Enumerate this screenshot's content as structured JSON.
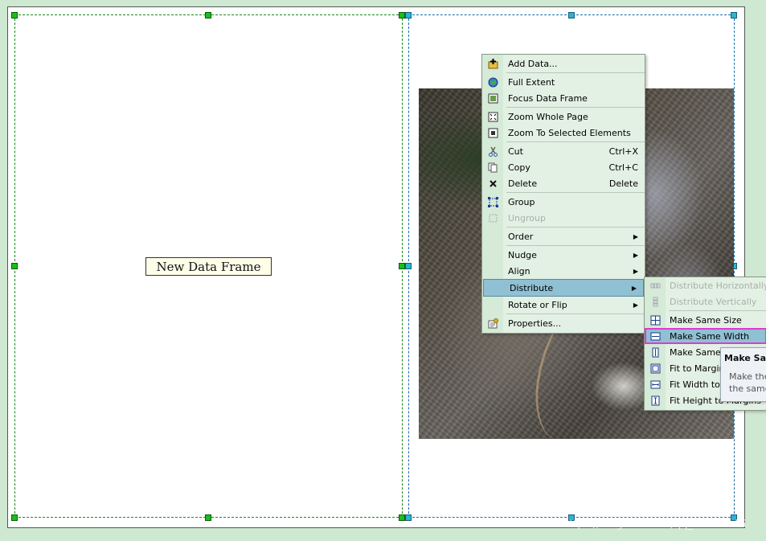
{
  "layout_view": {
    "new_data_frame_label": "New Data Frame"
  },
  "context_menu": {
    "items": [
      {
        "label": "Add Data...",
        "shortcut": "",
        "icon": "add-data-icon",
        "disabled": false,
        "submenu": false
      },
      {
        "label": "Full Extent",
        "shortcut": "",
        "icon": "globe-icon",
        "disabled": false,
        "submenu": false
      },
      {
        "label": "Focus Data Frame",
        "shortcut": "",
        "icon": "focus-frame-icon",
        "disabled": false,
        "submenu": false
      },
      {
        "label": "Zoom Whole Page",
        "shortcut": "",
        "icon": "zoom-page-icon",
        "disabled": false,
        "submenu": false
      },
      {
        "label": "Zoom To Selected Elements",
        "shortcut": "",
        "icon": "zoom-selected-icon",
        "disabled": false,
        "submenu": false
      },
      {
        "label": "Cut",
        "shortcut": "Ctrl+X",
        "icon": "scissors-icon",
        "disabled": false,
        "submenu": false
      },
      {
        "label": "Copy",
        "shortcut": "Ctrl+C",
        "icon": "copy-icon",
        "disabled": false,
        "submenu": false
      },
      {
        "label": "Delete",
        "shortcut": "Delete",
        "icon": "delete-icon",
        "disabled": false,
        "submenu": false
      },
      {
        "label": "Group",
        "shortcut": "",
        "icon": "group-icon",
        "disabled": false,
        "submenu": false
      },
      {
        "label": "Ungroup",
        "shortcut": "",
        "icon": "ungroup-icon",
        "disabled": true,
        "submenu": false
      },
      {
        "label": "Order",
        "shortcut": "",
        "icon": "",
        "disabled": false,
        "submenu": true
      },
      {
        "label": "Nudge",
        "shortcut": "",
        "icon": "",
        "disabled": false,
        "submenu": true
      },
      {
        "label": "Align",
        "shortcut": "",
        "icon": "",
        "disabled": false,
        "submenu": true
      },
      {
        "label": "Distribute",
        "shortcut": "",
        "icon": "",
        "disabled": false,
        "submenu": true
      },
      {
        "label": "Rotate or Flip",
        "shortcut": "",
        "icon": "",
        "disabled": false,
        "submenu": true
      },
      {
        "label": "Properties...",
        "shortcut": "",
        "icon": "properties-icon",
        "disabled": false,
        "submenu": false
      }
    ]
  },
  "distribute_submenu": {
    "items": [
      {
        "label": "Distribute Horizontally",
        "icon": "distribute-horizontal-icon",
        "disabled": true
      },
      {
        "label": "Distribute Vertically",
        "icon": "distribute-vertical-icon",
        "disabled": true
      },
      {
        "label": "Make Same Size",
        "icon": "same-size-icon",
        "disabled": false
      },
      {
        "label": "Make Same Width",
        "icon": "same-width-icon",
        "disabled": false
      },
      {
        "label": "Make Same Height",
        "icon": "same-height-icon",
        "disabled": false
      },
      {
        "label": "Fit to Margins",
        "icon": "fit-margins-icon",
        "disabled": false
      },
      {
        "label": "Fit Width to Margins",
        "icon": "fit-width-icon",
        "disabled": false
      },
      {
        "label": "Fit Height to Margins",
        "icon": "fit-height-icon",
        "disabled": false
      }
    ]
  },
  "tooltip": {
    "title": "Make Same Width",
    "line1": "Make the",
    "line2": "the same"
  },
  "watermark": "https://blog.csdn.net/qq_46071146"
}
